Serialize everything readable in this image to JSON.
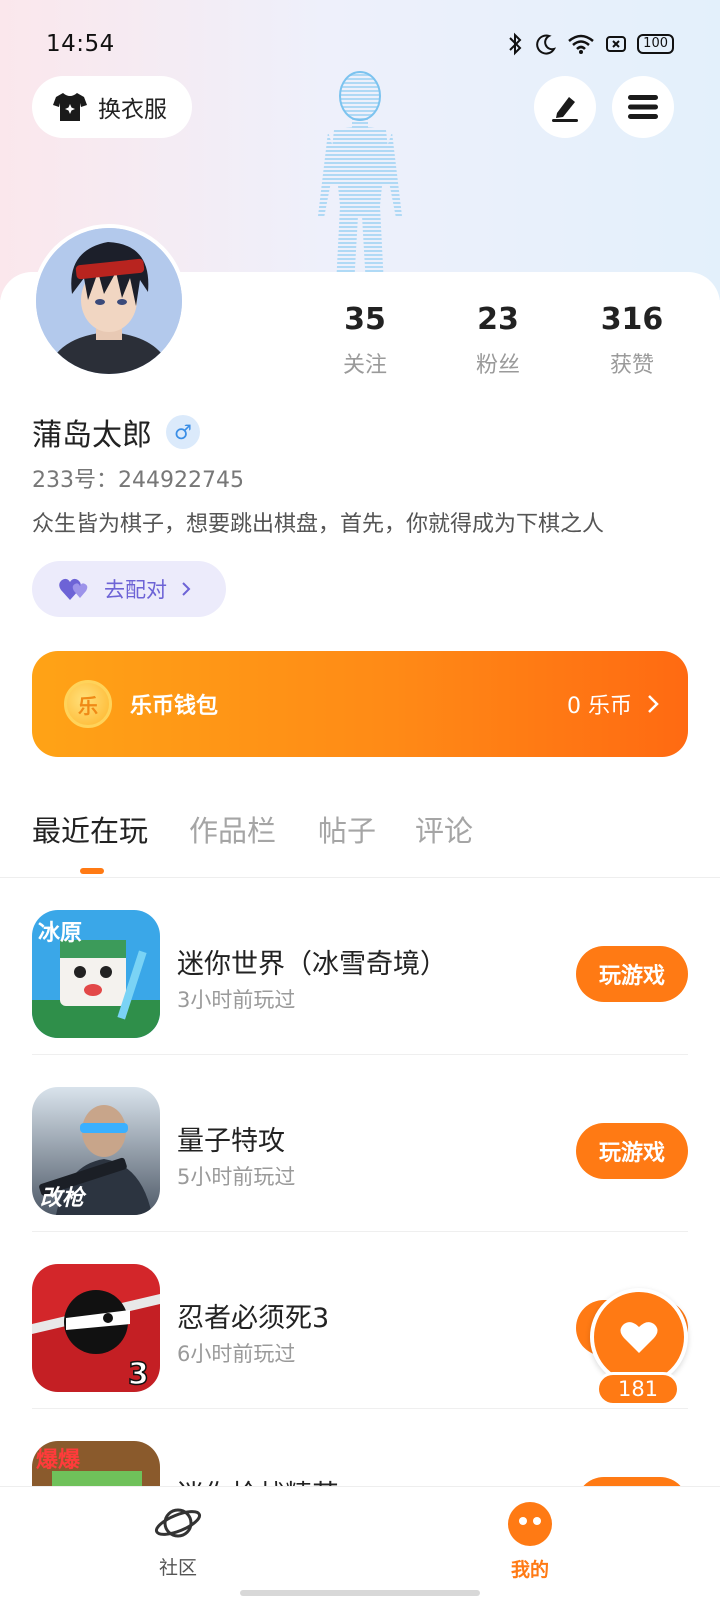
{
  "status_bar": {
    "time": "14:54",
    "battery": "100"
  },
  "header": {
    "outfit_label": "换衣服"
  },
  "profile": {
    "username": "蒲岛太郎",
    "gender_symbol": "♂",
    "uid": "233号：244922745",
    "bio": "众生皆为棋子，想要跳出棋盘，首先，你就得成为下棋之人",
    "match_label": "去配对",
    "stats": [
      {
        "value": "35",
        "label": "关注"
      },
      {
        "value": "23",
        "label": "粉丝"
      },
      {
        "value": "316",
        "label": "获赞"
      }
    ]
  },
  "wallet": {
    "coin_glyph": "乐",
    "title": "乐币钱包",
    "balance": "0 乐币"
  },
  "tabs": [
    {
      "label": "最近在玩",
      "active": true
    },
    {
      "label": "作品栏",
      "active": false
    },
    {
      "label": "帖子",
      "active": false
    },
    {
      "label": "评论",
      "active": false
    }
  ],
  "games": [
    {
      "name": "迷你世界（冰雪奇境）",
      "time": "3小时前玩过",
      "button": "玩游戏",
      "icon_text": "冰原"
    },
    {
      "name": "量子特攻",
      "time": "5小时前玩过",
      "button": "玩游戏",
      "icon_text": "改枪"
    },
    {
      "name": "忍者必须死3",
      "time": "6小时前玩过",
      "button": "玩游戏",
      "icon_text": "3"
    },
    {
      "name": "迷你枪战精英",
      "time": "",
      "button": "",
      "icon_text": "爆爆"
    }
  ],
  "like_count": "181",
  "bottom_nav": [
    {
      "label": "社区",
      "active": false
    },
    {
      "label": "我的",
      "active": true
    }
  ],
  "colors": {
    "accent": "#ff7a14",
    "match": "#6d63d6"
  }
}
